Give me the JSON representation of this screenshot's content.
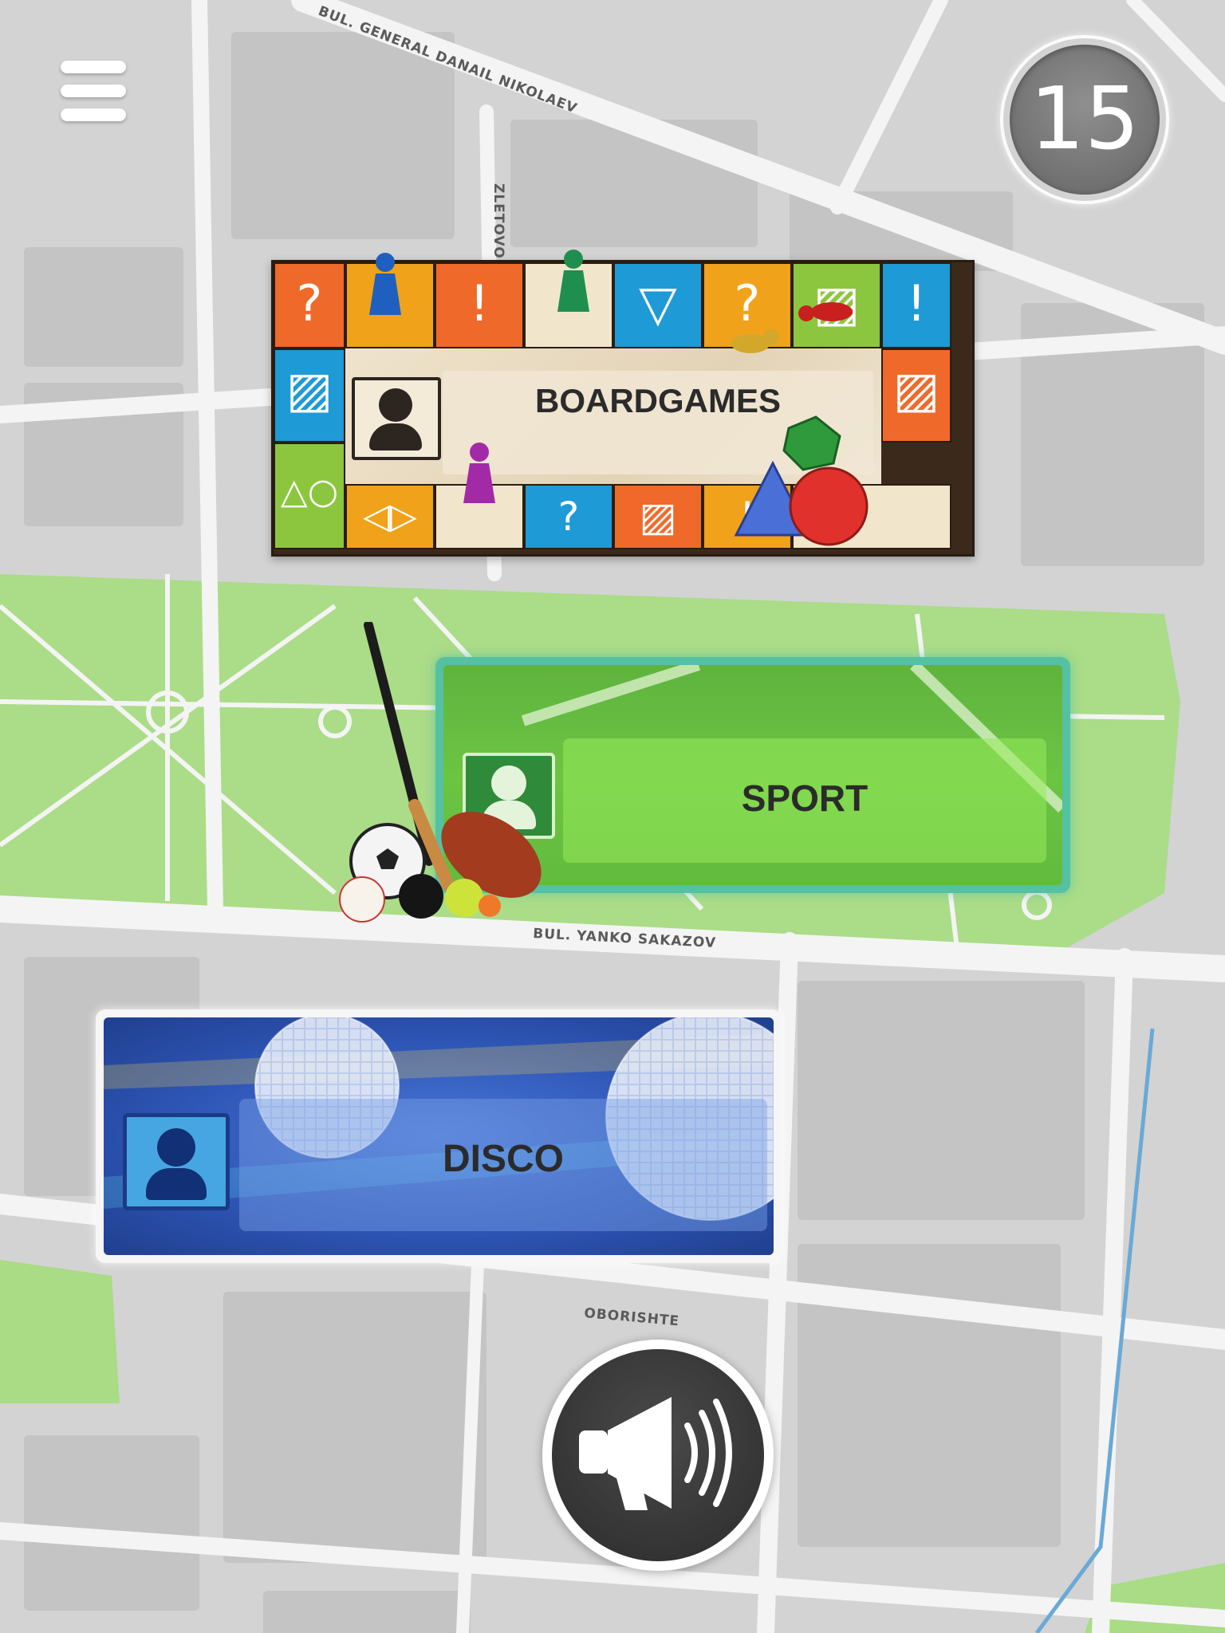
{
  "app": {
    "type": "map-lobby"
  },
  "map": {
    "street_labels": [
      "BUL. GENERAL DANAIL NIKOLAEV",
      "ZLETOVO",
      "BUL. YANKO SAKAZOV",
      "OBORISHTE"
    ],
    "colors": {
      "road": "#f2f2f2",
      "block": "#c9c9c9",
      "park": "#a9dc84",
      "canal": "#6aa9d6"
    }
  },
  "menu": {
    "icon": "hamburger-menu-icon"
  },
  "counter": {
    "value": "15"
  },
  "rooms": [
    {
      "id": "boardgames",
      "label": "BOARDGAMES",
      "theme_color": "#e8dcc4",
      "icon": "person-icon"
    },
    {
      "id": "sport",
      "label": "SPORT",
      "theme_color": "#6cc443",
      "icon": "person-icon"
    },
    {
      "id": "disco",
      "label": "DISCO",
      "theme_color": "#2e56b6",
      "icon": "person-icon"
    }
  ],
  "board_cells": {
    "top": [
      "?",
      "",
      "!",
      "",
      "▽",
      "?",
      "▨",
      "!"
    ],
    "bottom": [
      "△○",
      "◁▷",
      "",
      "?",
      "▨",
      "!",
      ""
    ],
    "left": [
      "▨"
    ],
    "right": [
      "▨"
    ]
  },
  "megaphone": {
    "icon": "megaphone-icon"
  }
}
